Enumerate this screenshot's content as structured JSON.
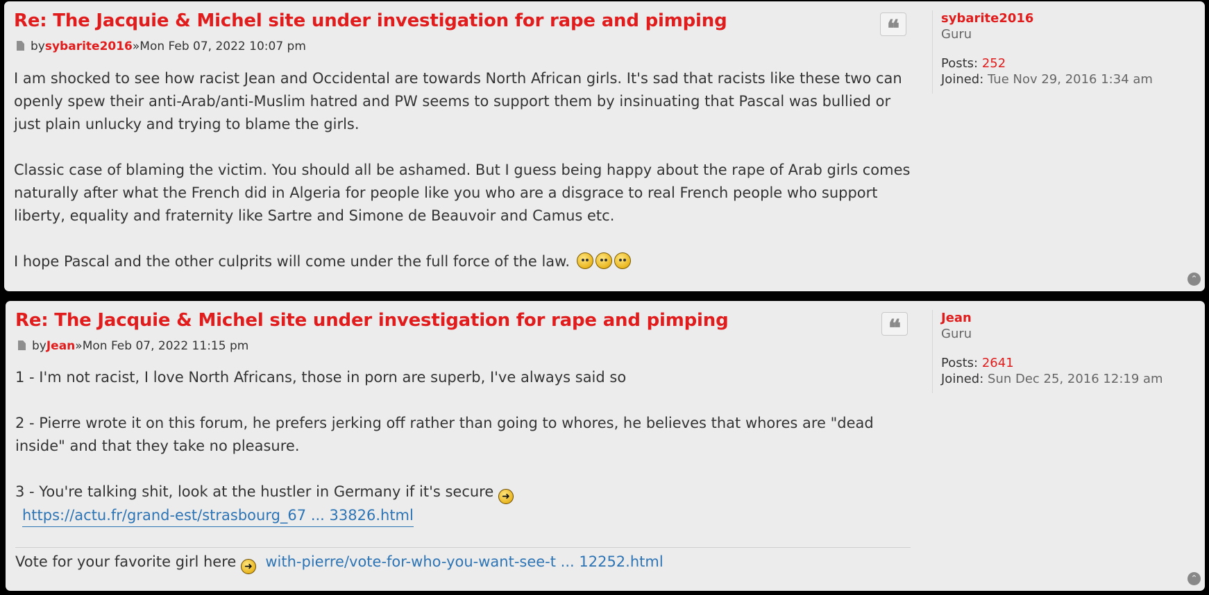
{
  "posts": [
    {
      "title": "Re: The Jacquie & Michel site under investigation for rape and pimping",
      "by": "by",
      "author": "sybarite2016",
      "sep": "»",
      "date": "Mon Feb 07, 2022 10:07 pm",
      "paragraphs": [
        "I am shocked to see how racist Jean and Occidental are towards North African girls. It's sad that racists like these two can openly spew their anti-Arab/anti-Muslim hatred and PW seems to support them by insinuating that Pascal was bullied or just plain unlucky and trying to blame the girls.",
        "Classic case of blaming the victim. You should all be ashamed. But I guess being happy about the rape of Arab girls comes naturally after what the French did in Algeria for people like you who are a disgrace to real French people who support liberty, equality and fraternity like Sartre and Simone de Beauvoir and Camus etc.",
        "I hope Pascal and the other culprits will come under the full force of the law."
      ],
      "smileys": [
        "grimace-smiley-icon",
        "raised-eyebrow-smiley-icon",
        "glasses-smiley-icon"
      ],
      "profile": {
        "username": "sybarite2016",
        "rank": "Guru",
        "posts_label": "Posts:",
        "posts": "252",
        "joined_label": "Joined:",
        "joined": "Tue Nov 29, 2016 1:34 am"
      }
    },
    {
      "title": "Re: The Jacquie & Michel site under investigation for rape and pimping",
      "by": "by",
      "author": "Jean",
      "sep": "»",
      "date": "Mon Feb 07, 2022 11:15 pm",
      "line1": "1 - I'm not racist, I love North Africans, those in porn are superb, I've always said so",
      "line2": "2 - Pierre wrote it on this forum, he prefers jerking off rather than going to whores, he believes that whores are \"dead inside\" and that they take no pleasure.",
      "line3": "3 - You're talking shit, look at the hustler in Germany if it's secure",
      "link": "https://actu.fr/grand-est/strasbourg_67 ... 33826.html",
      "signature_text": "Vote for your favorite girl here",
      "signature_link": "with-pierre/vote-for-who-you-want-see-t ... 12252.html",
      "profile": {
        "username": "Jean",
        "rank": "Guru",
        "posts_label": "Posts:",
        "posts": "2641",
        "joined_label": "Joined:",
        "joined": "Sun Dec 25, 2016 12:19 am"
      }
    }
  ],
  "icons": {
    "quote": "quote-icon",
    "top": "back-to-top-icon",
    "arrow": "right-arrow-smiley-icon",
    "post": "post-icon"
  },
  "glyphs": {
    "quote": "❝",
    "top": "⌃",
    "arrow": "➜"
  }
}
